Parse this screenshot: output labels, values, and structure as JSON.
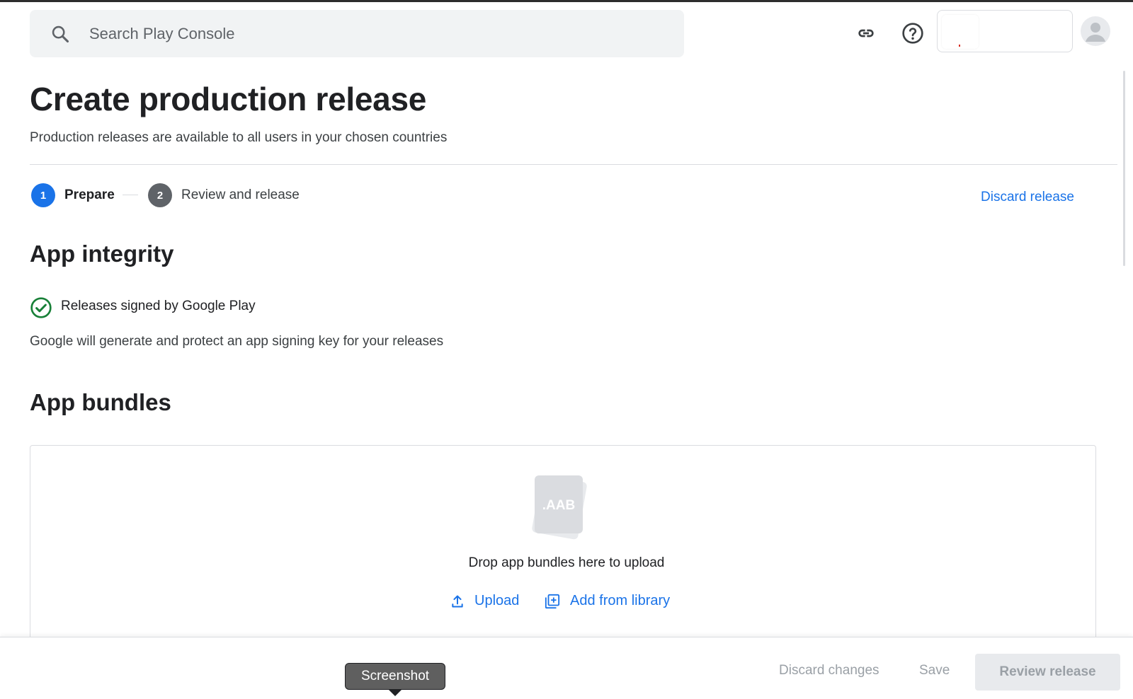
{
  "header": {
    "search": {
      "placeholder": "Search Play Console"
    },
    "icons": [
      "search-icon",
      "link-icon",
      "help-icon",
      "account-icon"
    ]
  },
  "page": {
    "title": "Create production release",
    "subtitle": "Production releases are available to all users in your chosen countries"
  },
  "steps": [
    {
      "number": "1",
      "label": "Prepare",
      "active": true
    },
    {
      "number": "2",
      "label": "Review and release",
      "active": false
    }
  ],
  "actions": {
    "discard_release": "Discard release"
  },
  "integrity": {
    "title": "App integrity",
    "status": "Releases signed by Google Play",
    "description": "Google will generate and protect an app signing key for your releases"
  },
  "bundles": {
    "title": "App bundles",
    "file_label": ".AAB",
    "drop_text": "Drop app bundles here to upload",
    "upload": "Upload",
    "add_from_library": "Add from library"
  },
  "footer": {
    "discard_changes": "Discard changes",
    "save": "Save",
    "review_release": "Review release"
  },
  "tooltip": {
    "text": "Screenshot"
  },
  "colors": {
    "accent": "#1a73e8",
    "success": "#188038",
    "step_inactive": "#5f6368",
    "disabled_text": "#9aa0a6",
    "search_bg": "#f1f3f4"
  }
}
